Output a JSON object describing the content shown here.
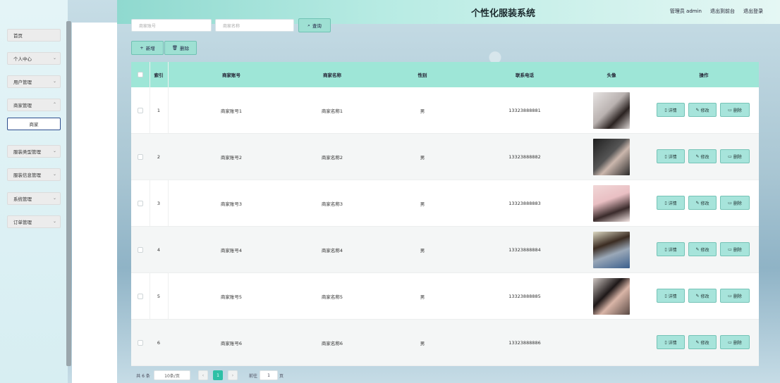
{
  "header": {
    "title": "个性化服装系统",
    "admin_label": "管理员 admin",
    "exit_to_home": "退出到前台",
    "logout": "退出登录"
  },
  "sidebar": {
    "items": [
      {
        "label": "首页",
        "chevron": false
      },
      {
        "label": "个人中心",
        "chevron": true
      },
      {
        "label": "用户管理",
        "chevron": true
      },
      {
        "label": "商家管理",
        "chevron": true
      },
      {
        "label": "商家",
        "chevron": false,
        "active": true
      },
      {
        "label": "服装类型管理",
        "chevron": true
      },
      {
        "label": "服装信息管理",
        "chevron": true
      },
      {
        "label": "系统管理",
        "chevron": true
      },
      {
        "label": "订单管理",
        "chevron": true
      }
    ]
  },
  "search": {
    "account_placeholder": "商家账号",
    "name_placeholder": "商家名称",
    "query_label": "查询"
  },
  "toolbar": {
    "add_label": "新增",
    "delete_label": "删除"
  },
  "table": {
    "columns": [
      "索引",
      "商家账号",
      "商家名称",
      "性别",
      "联系电话",
      "头像",
      "操作"
    ],
    "rows": [
      {
        "index": "1",
        "account": "商家账号1",
        "name": "商家名称1",
        "gender": "男",
        "phone": "13323888881",
        "has_avatar": true
      },
      {
        "index": "2",
        "account": "商家账号2",
        "name": "商家名称2",
        "gender": "男",
        "phone": "13323888882",
        "has_avatar": true
      },
      {
        "index": "3",
        "account": "商家账号3",
        "name": "商家名称3",
        "gender": "男",
        "phone": "13323888883",
        "has_avatar": true
      },
      {
        "index": "4",
        "account": "商家账号4",
        "name": "商家名称4",
        "gender": "男",
        "phone": "13323888884",
        "has_avatar": true
      },
      {
        "index": "5",
        "account": "商家账号5",
        "name": "商家名称5",
        "gender": "男",
        "phone": "13323888885",
        "has_avatar": true
      },
      {
        "index": "6",
        "account": "商家账号6",
        "name": "商家名称6",
        "gender": "男",
        "phone": "13323888886",
        "has_avatar": false
      }
    ],
    "actions": {
      "detail": "详情",
      "edit": "修改",
      "delete": "删除"
    }
  },
  "pagination": {
    "total": "共 6 条",
    "page_size": "10条/页",
    "current_page": "1",
    "goto_label": "前往",
    "goto_value": "1",
    "page_suffix": "页"
  },
  "colors": {
    "accent": "#9ee6d7",
    "primary": "#2ec0a6",
    "header_start": "#8fd9cf"
  }
}
